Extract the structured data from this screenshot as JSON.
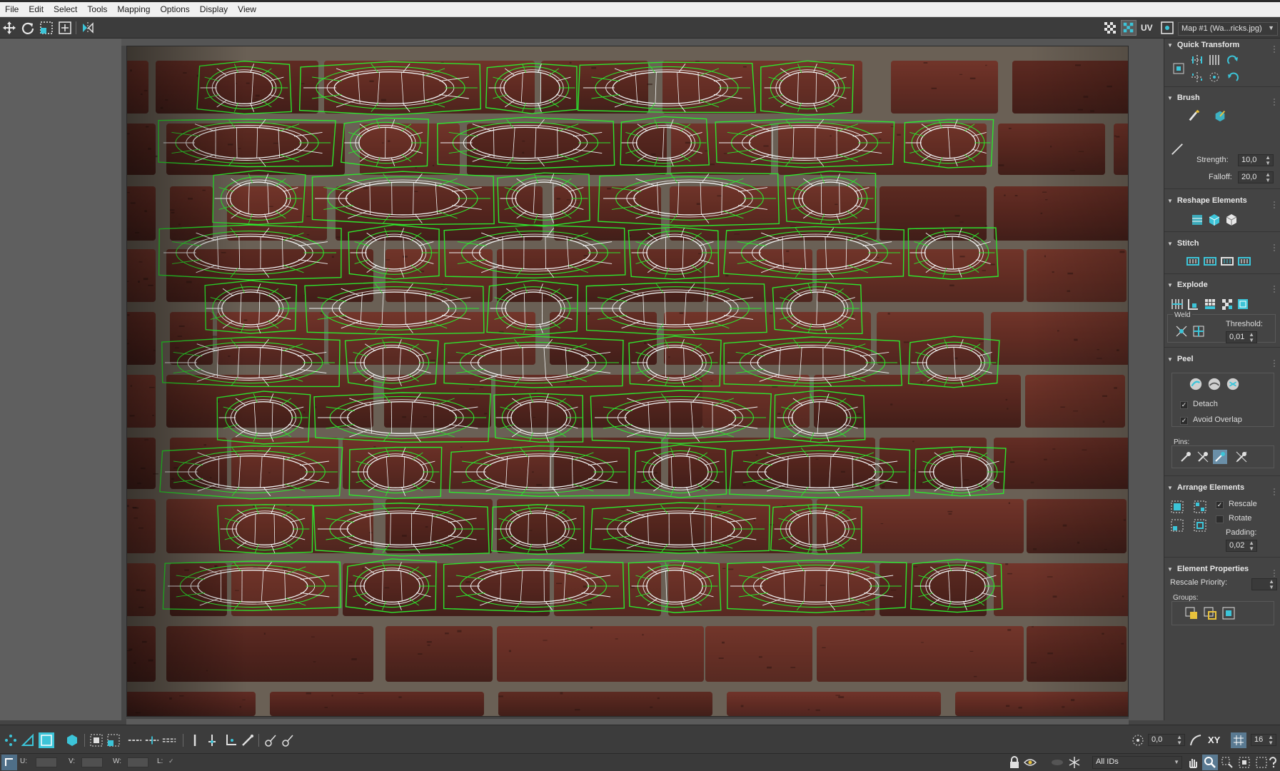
{
  "menu": [
    "File",
    "Edit",
    "Select",
    "Tools",
    "Mapping",
    "Options",
    "Display",
    "View"
  ],
  "top_toolbar": {
    "icons": [
      "move-icon",
      "rotate-icon",
      "scale-icon",
      "freeform-icon",
      "mirror-icon"
    ],
    "uv_label": "UV",
    "map_dropdown": "Map #1 (Wa...ricks.jpg)"
  },
  "panel": {
    "quick_transform": "Quick Transform",
    "brush": "Brush",
    "strength_label": "Strength:",
    "strength_value": "10,0",
    "falloff_label": "Falloff:",
    "falloff_value": "20,0",
    "reshape_elements": "Reshape Elements",
    "stitch": "Stitch",
    "explode": "Explode",
    "weld": "Weld",
    "threshold_label": "Threshold:",
    "threshold_value": "0,01",
    "peel": "Peel",
    "detach": "Detach",
    "avoid_overlap": "Avoid Overlap",
    "pins": "Pins:",
    "arrange_elements": "Arrange Elements",
    "rescale": "Rescale",
    "rotate": "Rotate",
    "padding_label": "Padding:",
    "padding_value": "0,02",
    "element_properties": "Element Properties",
    "rescale_priority": "Rescale Priority:",
    "groups": "Groups:"
  },
  "bottom_toolbar": {
    "angle_value": "0,0",
    "xy_label": "XY",
    "grid_value": "16"
  },
  "status": {
    "u_label": "U:",
    "v_label": "V:",
    "w_label": "W:",
    "l_label": "L:",
    "ids_dropdown": "All IDs"
  },
  "colors": {
    "uv_wire_green": "#2ee62e",
    "uv_wire_white": "#f2f2f2",
    "brick_base": "#5a2a22",
    "mortar": "#6c6357",
    "accent_cyan": "#3cc4d8"
  }
}
